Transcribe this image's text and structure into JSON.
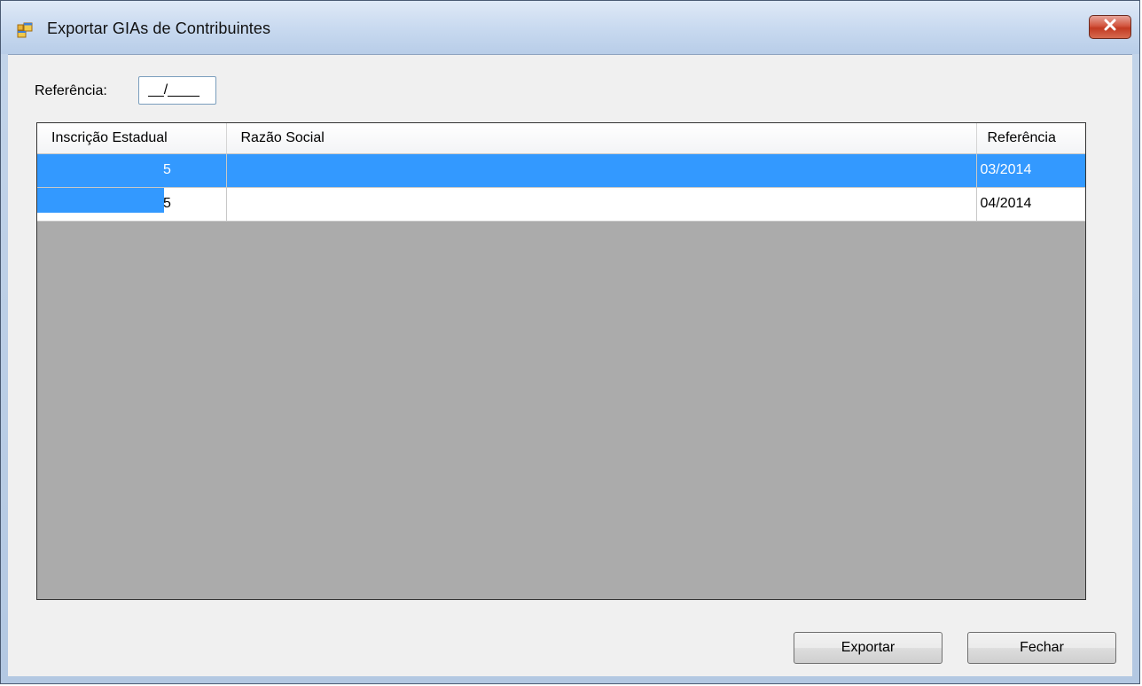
{
  "window": {
    "title": "Exportar GIAs de Contribuintes"
  },
  "filter": {
    "label": "Referência:",
    "value": "__/____"
  },
  "grid": {
    "columns": [
      "Inscrição Estadual",
      "Razão Social",
      "Referência"
    ],
    "rows": [
      {
        "inscricao_estadual": "5",
        "razao_social": "",
        "referencia": "03/2014",
        "selected": true
      },
      {
        "inscricao_estadual": "5",
        "razao_social": "",
        "referencia": "04/2014",
        "selected": false
      }
    ]
  },
  "buttons": {
    "export_label": "Exportar",
    "close_label": "Fechar"
  },
  "colors": {
    "selection": "#3399ff",
    "grid_background": "#ababab",
    "close_button": "#c23a22"
  },
  "icons": {
    "app": "window-app-icon",
    "close": "close-icon"
  }
}
